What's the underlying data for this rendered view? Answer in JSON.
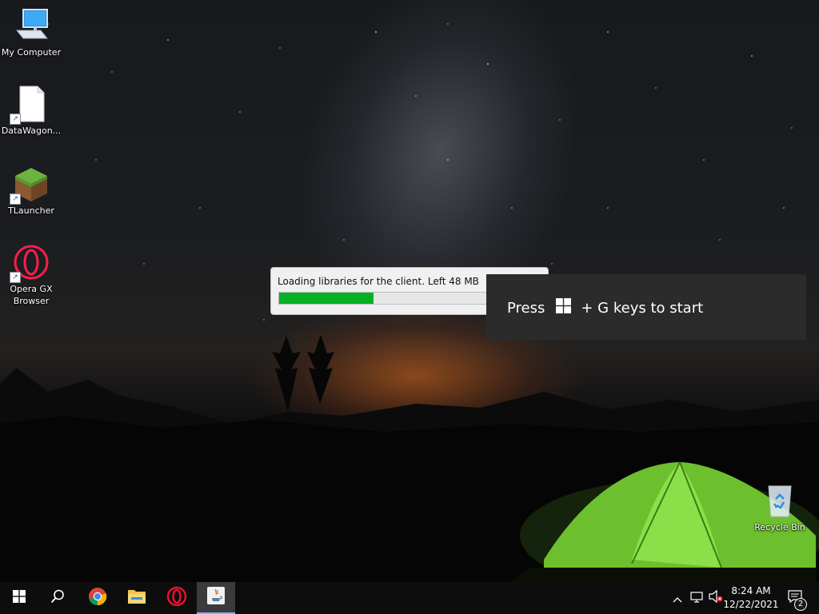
{
  "desktop": {
    "icons": [
      {
        "label": "My Computer",
        "icon": "computer-icon"
      },
      {
        "label": "DataWagon...",
        "icon": "file-icon"
      },
      {
        "label": "TLauncher",
        "icon": "minecraft-grass-block-icon"
      },
      {
        "label": "Opera GX\nBrowser",
        "icon": "opera-gx-icon"
      },
      {
        "label": "Recycle Bin",
        "icon": "recycle-bin-icon"
      }
    ]
  },
  "loader": {
    "message": "Loading libraries for the client. Left 48 MB",
    "progress_percent": 36,
    "fill_color": "#06b025"
  },
  "game_bar_toast": {
    "press_text": "Press",
    "keys_text": "+ G keys to start",
    "key_icon": "windows-logo-icon"
  },
  "taskbar": {
    "buttons": [
      {
        "name": "start",
        "icon": "windows-logo-icon"
      },
      {
        "name": "search",
        "icon": "search-icon"
      },
      {
        "name": "chrome",
        "icon": "chrome-icon"
      },
      {
        "name": "file-explorer",
        "icon": "folder-icon"
      },
      {
        "name": "opera",
        "icon": "opera-icon"
      },
      {
        "name": "java",
        "icon": "java-icon",
        "active": true
      }
    ],
    "tray": {
      "chevron_icon": "chevron-up-icon",
      "network_icon": "network-icon",
      "volume_icon": "volume-muted-icon",
      "time": "8:24 AM",
      "date": "12/22/2021",
      "notifications_icon": "notification-center-icon",
      "notification_count": "2"
    }
  }
}
